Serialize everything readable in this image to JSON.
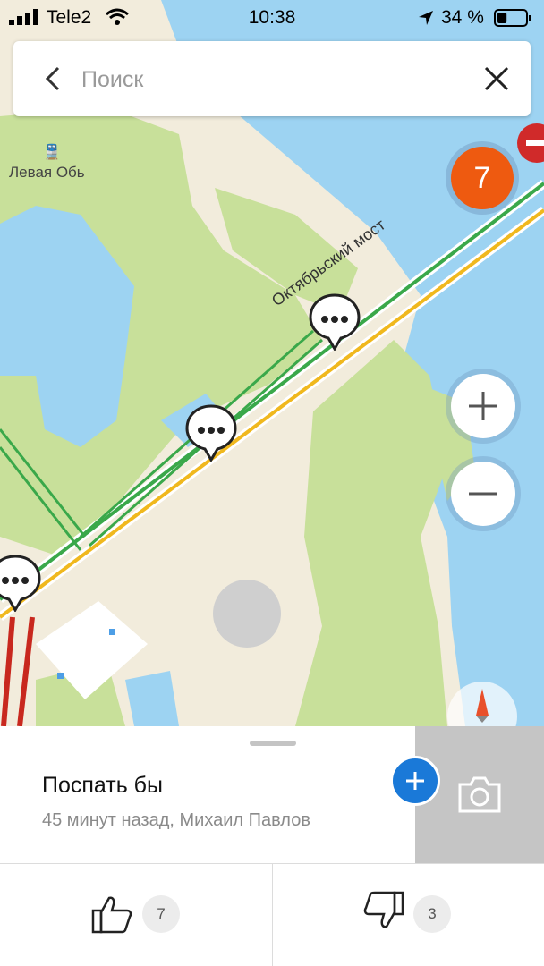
{
  "status_bar": {
    "carrier": "Tele2",
    "time": "10:38",
    "battery_percent": "34 %",
    "battery_level": 0.34
  },
  "search": {
    "placeholder": "Поиск",
    "back_icon": "chevron-left-icon",
    "close_icon": "close-icon"
  },
  "map": {
    "place_label": "Левая Обь",
    "road_label": "Октябрьский мост",
    "cluster_count": "7",
    "colors": {
      "water": "#9dd3f2",
      "land": "#f2ecdc",
      "park": "#c8e09a",
      "traffic_green": "#3aa84a",
      "traffic_yellow": "#f0b81e",
      "traffic_red": "#c8281e",
      "cluster": "#ee5a10"
    }
  },
  "event": {
    "title": "Поспать бы",
    "meta": "45 минут назад, Михаил Павлов",
    "likes": "7",
    "dislikes": "3"
  },
  "accent_color": "#1a79d8"
}
